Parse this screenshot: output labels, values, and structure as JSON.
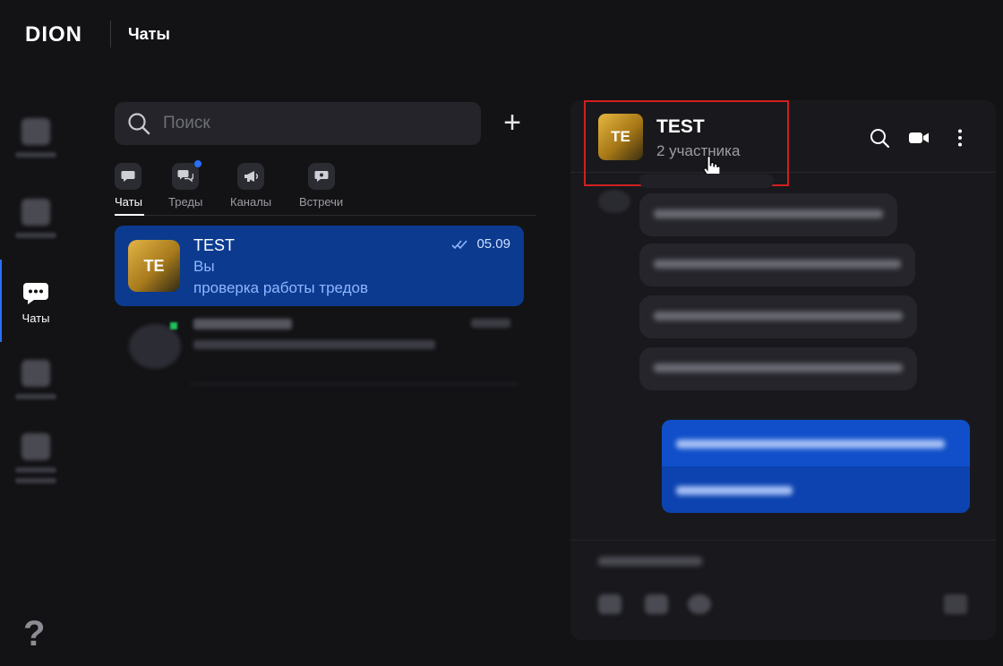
{
  "app": {
    "logo": "DION",
    "section_title": "Чаты"
  },
  "nav": {
    "items": [
      {
        "label": "",
        "icon": "blurred-icon"
      },
      {
        "label": "",
        "icon": "blurred-icon"
      },
      {
        "label": "Чаты",
        "icon": "chat-bubble-icon",
        "active": true
      },
      {
        "label": "",
        "icon": "blurred-icon"
      },
      {
        "label": "",
        "icon": "blurred-icon"
      }
    ],
    "help_glyph": "?"
  },
  "search": {
    "placeholder": "Поиск",
    "add_glyph": "+"
  },
  "tabs": [
    {
      "label": "Чаты",
      "active": true
    },
    {
      "label": "Треды",
      "has_badge": true
    },
    {
      "label": "Каналы"
    },
    {
      "label": "Встречи"
    }
  ],
  "chat_list": [
    {
      "avatar_text": "TE",
      "name": "TEST",
      "date": "05.09",
      "subtitle": "Вы",
      "preview": "проверка работы тредов",
      "selected": true
    }
  ],
  "conversation": {
    "avatar_text": "TE",
    "title": "TEST",
    "subtitle": "2 участника",
    "colors": {
      "accent": "#2a6ff7",
      "selected": "#0b3a8f",
      "highlight": "#d02020"
    }
  }
}
